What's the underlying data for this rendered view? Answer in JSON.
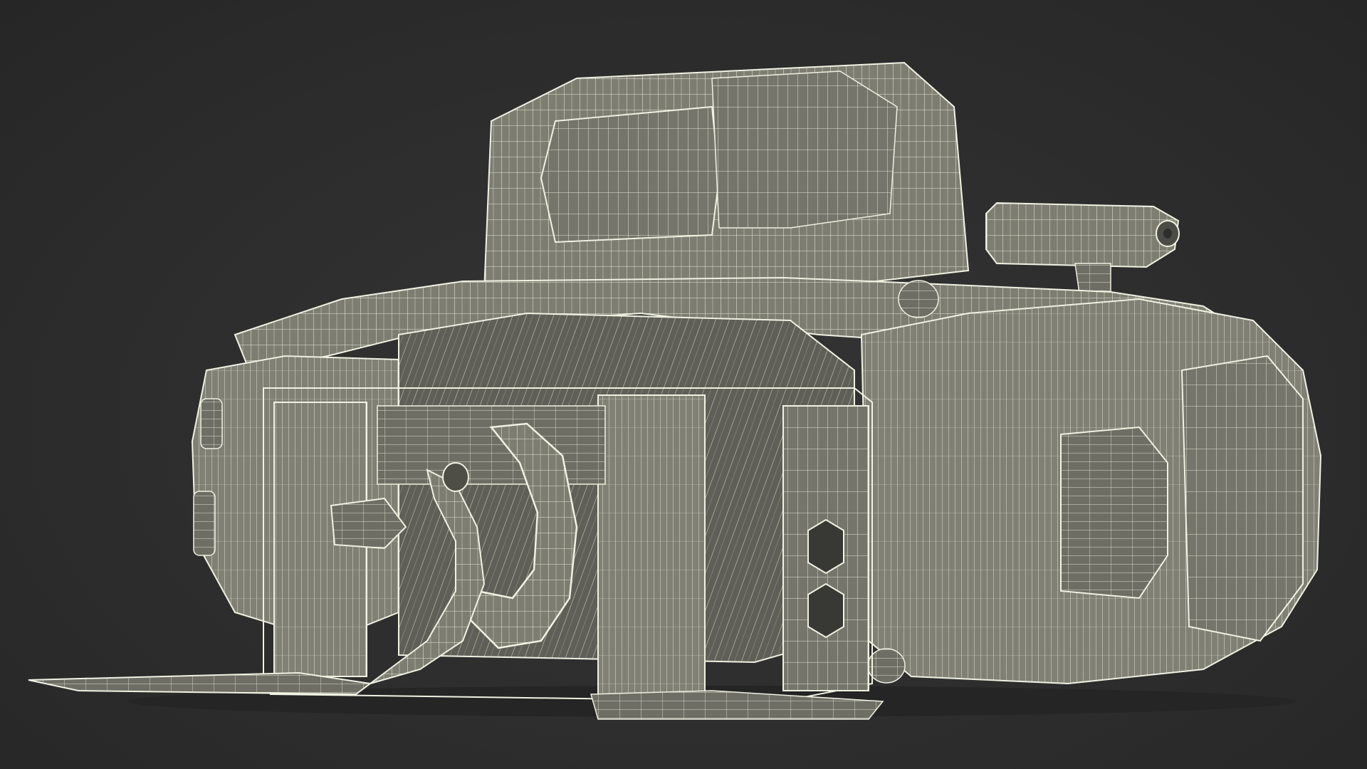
{
  "scene": {
    "subject": "winch",
    "render_style": "wireframe",
    "background_color": "#2e2e2e",
    "surface_color": "#7b7b70",
    "wire_color": "#e9ecd9"
  }
}
